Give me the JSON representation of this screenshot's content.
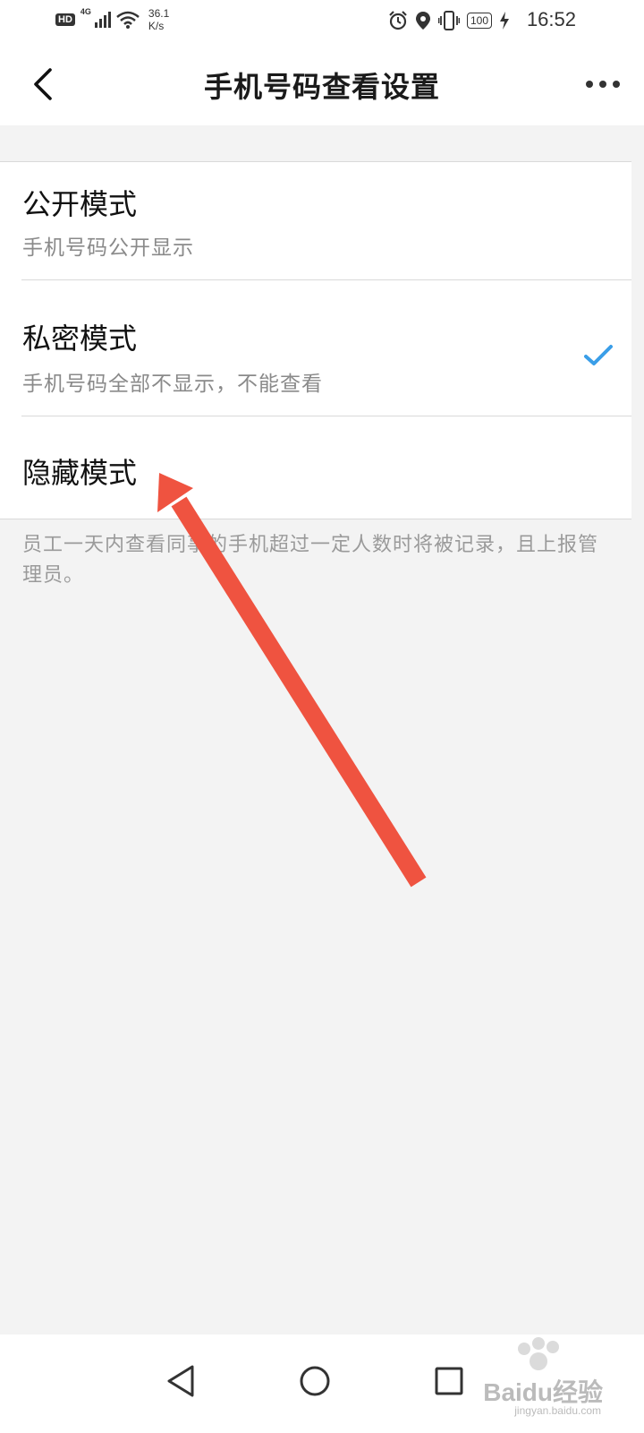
{
  "status_bar": {
    "hd_label": "HD",
    "network_label": "4G",
    "speed_value": "36.1",
    "speed_unit": "K/s",
    "battery_label": "100",
    "time": "16:52"
  },
  "header": {
    "title": "手机号码查看设置"
  },
  "options": [
    {
      "title": "公开模式",
      "description": "手机号码公开显示",
      "selected": false
    },
    {
      "title": "私密模式",
      "description": "手机号码全部不显示，不能查看",
      "selected": true
    },
    {
      "title": "隐藏模式",
      "description": "",
      "selected": false
    }
  ],
  "footer_note": "员工一天内查看同事的手机超过一定人数时将被记录，且上报管理员。",
  "colors": {
    "check": "#3a9ee8",
    "annotation_arrow": "#ef5340"
  },
  "watermark": {
    "text": "Baidu经验",
    "sub": "jingyan.baidu.com"
  }
}
